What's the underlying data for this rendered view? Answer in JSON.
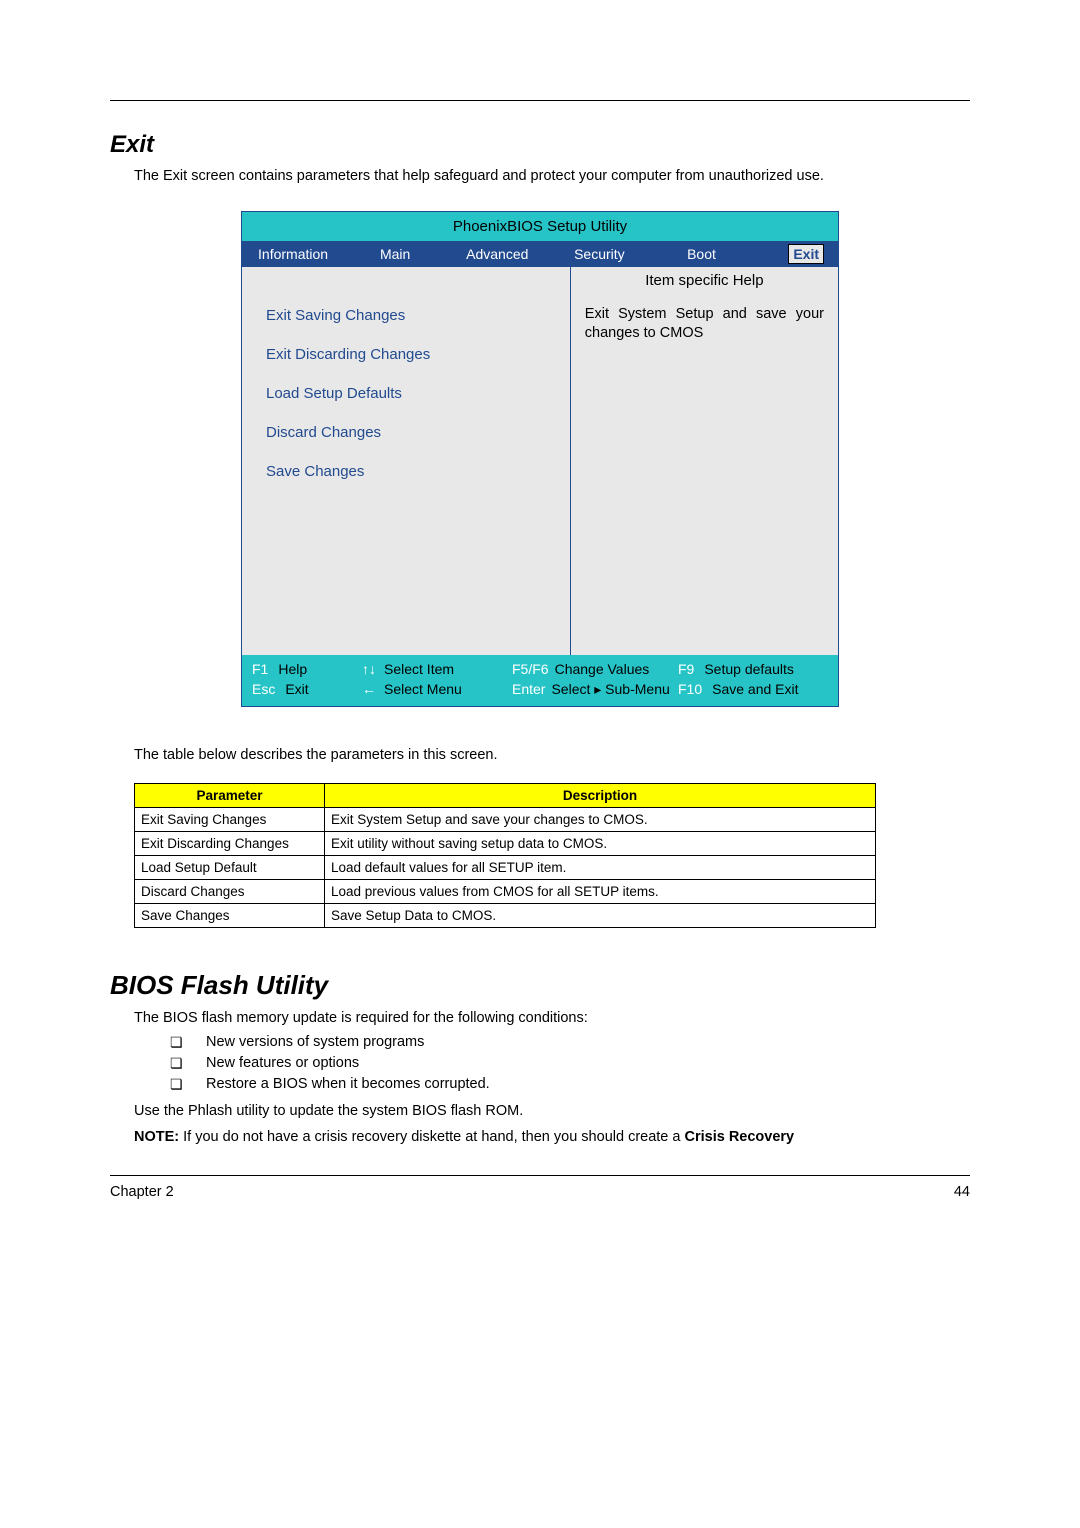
{
  "section1": {
    "heading": "Exit",
    "intro": "The Exit screen contains parameters that help safeguard and protect your computer from unauthorized use."
  },
  "bios": {
    "title": "PhoenixBIOS Setup Utility",
    "tabs": [
      "Information",
      "Main",
      "Advanced",
      "Security",
      "Boot",
      "Exit"
    ],
    "menu": [
      "Exit Saving Changes",
      "Exit Discarding Changes",
      "Load Setup Defaults",
      "Discard Changes",
      "Save Changes"
    ],
    "help_header": "Item specific Help",
    "help_body": "Exit System Setup and save your changes to CMOS",
    "footer": {
      "row1": {
        "k1": "F1",
        "l1": "Help",
        "k2": "↑↓",
        "l2": "Select Item",
        "k3": "F5/F6",
        "l3": "Change Values",
        "k4": "F9",
        "l4": "Setup defaults"
      },
      "row2": {
        "k1": "Esc",
        "l1": "Exit",
        "k2": "←",
        "l2": "Select Menu",
        "k3": "Enter",
        "l3": "Select ▸ Sub-Menu",
        "k4": "F10",
        "l4": "Save and Exit"
      }
    }
  },
  "param_intro": "The table below describes the parameters in this screen.",
  "param_table": {
    "headers": [
      "Parameter",
      "Description"
    ],
    "rows": [
      [
        "Exit Saving Changes",
        "Exit System Setup and save your changes to CMOS."
      ],
      [
        "Exit Discarding Changes",
        "Exit utility without saving setup data to CMOS."
      ],
      [
        "Load Setup Default",
        "Load default values for all SETUP item."
      ],
      [
        "Discard Changes",
        "Load previous values from CMOS for all SETUP items."
      ],
      [
        "Save Changes",
        "Save Setup Data to CMOS."
      ]
    ]
  },
  "section2": {
    "heading": "BIOS Flash Utility",
    "intro": "The BIOS flash memory update is required for the following conditions:",
    "bullets": [
      "New versions of system programs",
      "New features or options",
      "Restore a BIOS when it becomes corrupted."
    ],
    "use_line": "Use the Phlash utility to update the system BIOS flash ROM.",
    "note_prefix": "NOTE: ",
    "note_body": "If you do not have a crisis recovery diskette at hand, then you should create a ",
    "note_bold": "Crisis Recovery"
  },
  "footer": {
    "left": "Chapter 2",
    "right": "44"
  }
}
